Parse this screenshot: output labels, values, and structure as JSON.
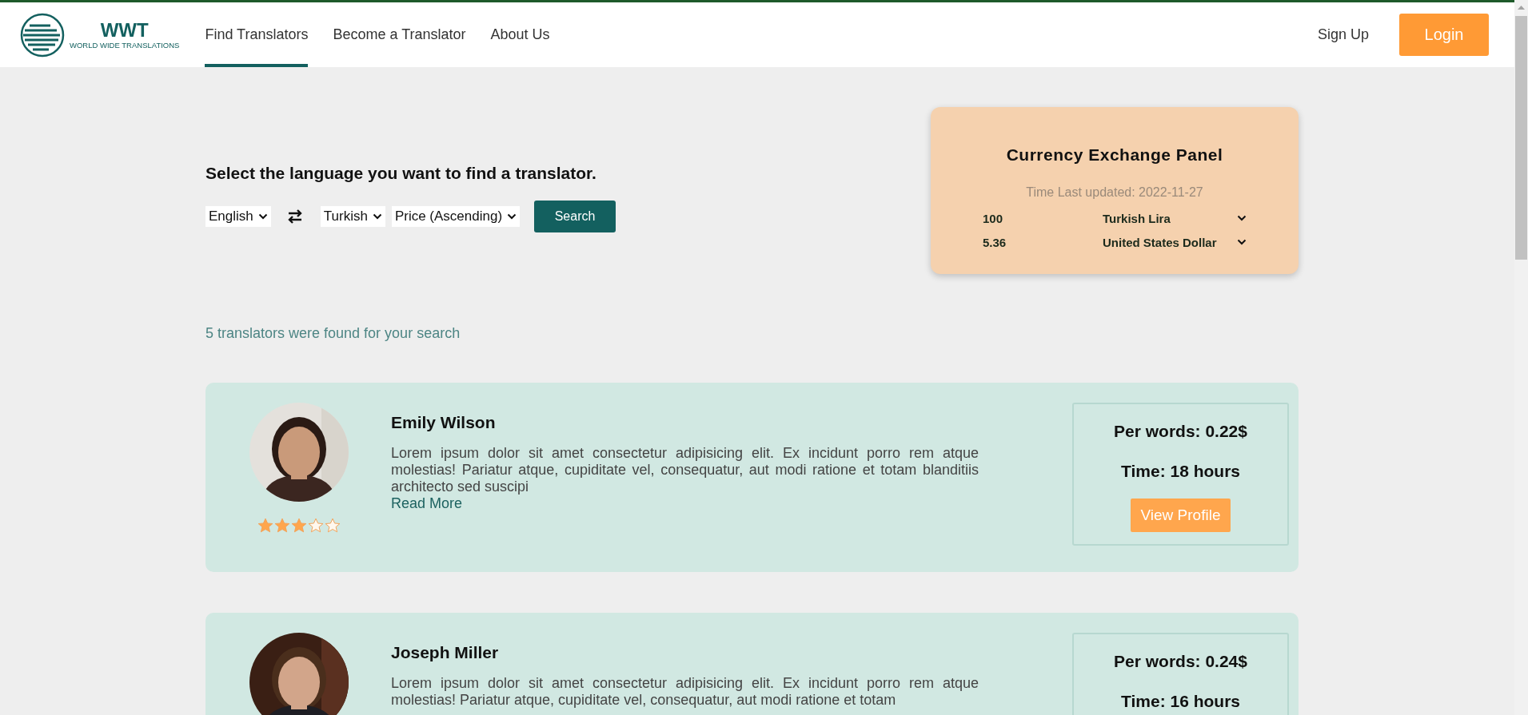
{
  "header": {
    "logo": {
      "title": "WWT",
      "subtitle": "WORLD WIDE TRANSLATIONS"
    },
    "nav": [
      {
        "label": "Find Translators",
        "selected": true
      },
      {
        "label": "Become a Translator",
        "selected": false
      },
      {
        "label": "About Us",
        "selected": false
      }
    ],
    "sign_up": "Sign Up",
    "login": "Login"
  },
  "search": {
    "heading": "Select the language you want to find a translator.",
    "from_language": "English",
    "to_language": "Turkish",
    "sort": "Price (Ascending)",
    "button": "Search"
  },
  "currency_panel": {
    "title": "Currency Exchange Panel",
    "updated": "Time Last updated: 2022-11-27",
    "rows": [
      {
        "amount": "100",
        "currency": "Turkish Lira"
      },
      {
        "amount": "5.36",
        "currency": "United States Dollar"
      }
    ]
  },
  "results_text": "5 translators were found for your search",
  "translators": [
    {
      "name": "Emily Wilson",
      "bio": "Lorem ipsum dolor sit amet consectetur adipisicing elit. Ex incidunt porro rem atque molestias! Pariatur atque, cupiditate vel, consequatur, aut modi ratione et totam blanditiis architecto sed suscipi",
      "read_more": "Read More",
      "stars": 3,
      "price": "Per words: 0.22$",
      "time": "Time: 18 hours",
      "button": "View Profile"
    },
    {
      "name": "Joseph Miller",
      "bio": "Lorem ipsum dolor sit amet consectetur adipisicing elit. Ex incidunt porro rem atque molestias! Pariatur atque, cupiditate vel, consequatur, aut modi ratione et totam",
      "price": "Per words: 0.24$",
      "time": "Time: 16 hours"
    }
  ]
}
